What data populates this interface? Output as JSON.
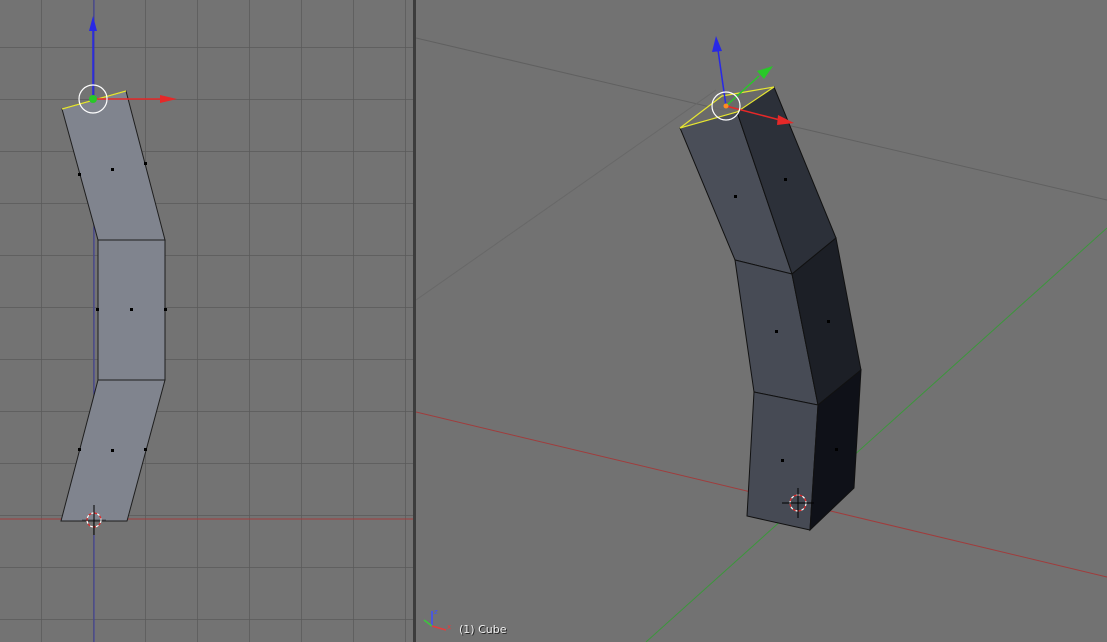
{
  "viewport_right": {
    "object_label": "(1) Cube"
  },
  "colors": {
    "background": "#727272",
    "grid_line": "#5a5a5a",
    "x_axis": "#c83232",
    "y_axis": "#3ca03c",
    "z_axis": "#3232c8",
    "mesh_face_left": "#80848e",
    "mesh_face_right_dark": "#262a33",
    "selected_edge": "#e6e632",
    "cursor_ring": "#ffffff"
  },
  "icons": {
    "transform_manipulator": "translate-arrows-icon",
    "view_cursor": "3d-cursor-icon",
    "axis_gizmo": "xyz-axis-icon"
  }
}
